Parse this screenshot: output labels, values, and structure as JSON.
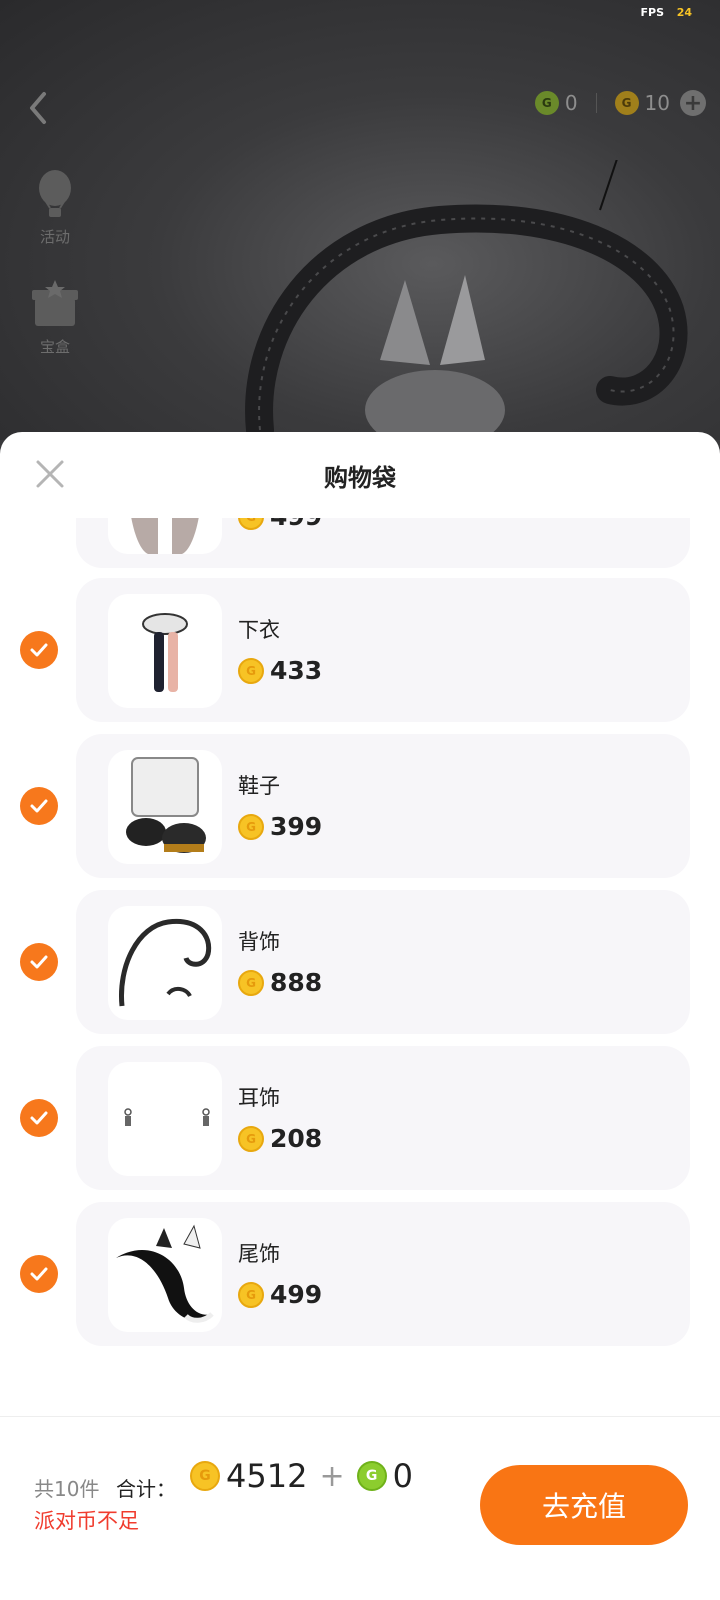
{
  "status": {
    "fps_label": "FPS",
    "fps_value": "24"
  },
  "topbar": {
    "green_currency_value": "0",
    "gold_currency_value": "10",
    "add_button_symbol": "+"
  },
  "side_menu": [
    {
      "label": "活动",
      "icon": "hot-air-balloon-icon"
    },
    {
      "label": "宝盒",
      "icon": "gift-box-icon"
    }
  ],
  "sheet": {
    "title": "购物袋",
    "items": [
      {
        "name": "",
        "price": "499",
        "checked": true,
        "partial": true
      },
      {
        "name": "下衣",
        "price": "433",
        "checked": true
      },
      {
        "name": "鞋子",
        "price": "399",
        "checked": true
      },
      {
        "name": "背饰",
        "price": "888",
        "checked": true
      },
      {
        "name": "耳饰",
        "price": "208",
        "checked": true
      },
      {
        "name": "尾饰",
        "price": "499",
        "checked": true
      }
    ]
  },
  "footer": {
    "count_label": "共10件",
    "total_label": "合计：",
    "gold_total": "4512",
    "plus": "+",
    "green_total": "0",
    "warning": "派对币不足",
    "recharge_label": "去充值"
  },
  "colors": {
    "accent_orange": "#f97514",
    "check_orange": "#f7781c",
    "coin_gold": "#f7c325",
    "coin_green": "#8ccd2e",
    "warning_red": "#f03c2e"
  }
}
